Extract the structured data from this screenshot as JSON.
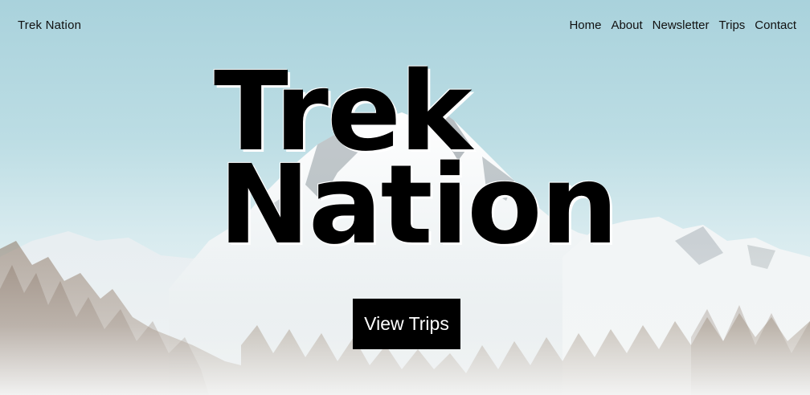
{
  "header": {
    "brand": "Trek Nation",
    "nav": [
      {
        "label": "Home"
      },
      {
        "label": "About"
      },
      {
        "label": "Newsletter"
      },
      {
        "label": "Trips"
      },
      {
        "label": "Contact"
      }
    ]
  },
  "hero": {
    "title_line1": "Trek",
    "title_line2": "Nation",
    "cta_label": "View Trips",
    "background": "snowy-mountain-forest-photo"
  },
  "colors": {
    "sky": "#a9d2dc",
    "text": "#111111",
    "button_bg": "#000000",
    "button_text": "#ffffff"
  }
}
